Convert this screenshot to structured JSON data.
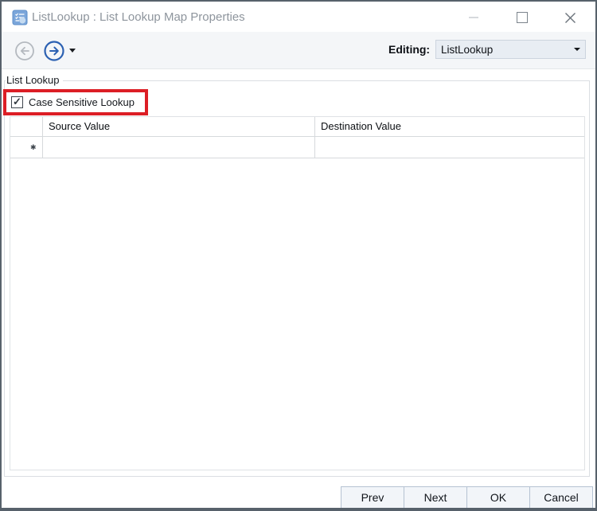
{
  "window": {
    "title": "ListLookup : List Lookup Map Properties"
  },
  "toolbar": {
    "editing_label": "Editing:",
    "editing_value": "ListLookup"
  },
  "groupbox": {
    "label": "List Lookup"
  },
  "checkbox": {
    "label": "Case Sensitive Lookup",
    "checked": true,
    "check_glyph": "✓"
  },
  "grid": {
    "columns": [
      "Source Value",
      "Destination Value"
    ],
    "new_row_indicator": "✱",
    "rows": [
      {
        "source_value": "",
        "destination_value": ""
      }
    ]
  },
  "footer": {
    "buttons": [
      "Prev",
      "Next",
      "OK",
      "Cancel"
    ]
  },
  "colors": {
    "annotation_red": "#DC1E25",
    "forward_blue": "#2C61B2",
    "disabled_gray": "#B4B9BF",
    "window_border": "#57616B",
    "title_text": "#8E959D",
    "toolbar_bg": "#F4F6F8"
  }
}
